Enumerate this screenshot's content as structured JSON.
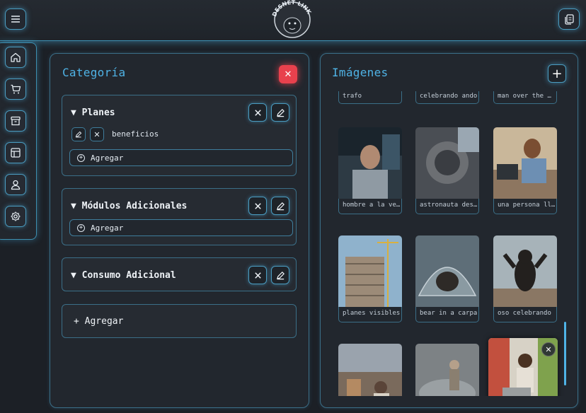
{
  "header": {
    "menu_icon": "hamburger-menu-icon",
    "logo_text": "DESNET LINK",
    "pages_icon": "copy-pages-icon"
  },
  "sidebar": {
    "items": [
      {
        "icon": "home-icon"
      },
      {
        "icon": "cart-icon"
      },
      {
        "icon": "archive-icon"
      },
      {
        "icon": "layout-icon"
      },
      {
        "icon": "user-icon"
      },
      {
        "icon": "settings-icon"
      }
    ]
  },
  "categoria": {
    "title": "Categoría",
    "close_label": "✕",
    "groups": [
      {
        "title": "▼ Planes",
        "items": [
          {
            "label": "beneficios"
          }
        ],
        "add_label": "Agregar"
      },
      {
        "title": "▼ Módulos Adicionales",
        "items": [],
        "add_label": "Agregar"
      },
      {
        "title": "▼ Consumo Adicional",
        "items": []
      }
    ],
    "add_group_label": "+ Agregar"
  },
  "imagenes": {
    "title": "Imágenes",
    "add_label": "+",
    "images": [
      {
        "caption": "trafo"
      },
      {
        "caption": "celebrando ando"
      },
      {
        "caption": "man over the …"
      },
      {
        "caption": "hombre a la ve…"
      },
      {
        "caption": "astronauta des…"
      },
      {
        "caption": "una persona ll…"
      },
      {
        "caption": "planes visibles"
      },
      {
        "caption": "bear in a carpa"
      },
      {
        "caption": "oso celebrando"
      }
    ]
  },
  "colors": {
    "accent": "#4fb3e6",
    "danger": "#e8414d",
    "background": "#1c2026"
  }
}
